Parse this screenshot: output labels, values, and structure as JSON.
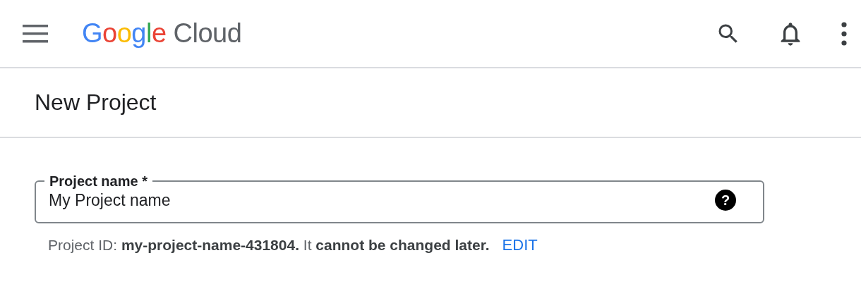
{
  "header": {
    "logo": {
      "brand": "Google",
      "product": "Cloud"
    }
  },
  "page_title": "New Project",
  "project_name_field": {
    "label": "Project name *",
    "value": "My Project name",
    "help_glyph": "?"
  },
  "hint": "Project ID: **my-project-name-431804.** It **cannot be changed later.**",
  "edit_link": "EDIT"
}
